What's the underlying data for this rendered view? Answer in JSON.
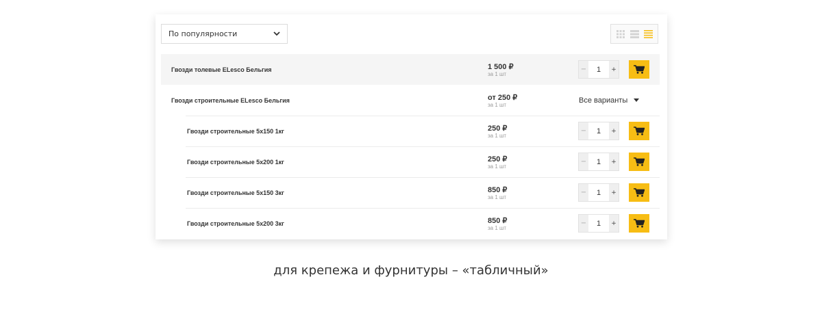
{
  "sort": {
    "selected": "По популярности"
  },
  "view_modes": [
    {
      "name": "grid",
      "active": false
    },
    {
      "name": "list",
      "active": false
    },
    {
      "name": "table",
      "active": true
    }
  ],
  "colors": {
    "accent": "#f7bd14",
    "inactive_icon": "#d4d4d4",
    "row_shade": "#f5f5f5"
  },
  "products": [
    {
      "name": "Гвозди толевые ELesco Бельгия",
      "price": "1 500 ₽",
      "unit": "за 1 шт",
      "qty": "1"
    },
    {
      "name": "Гвозди строительные ELesco Бельгия",
      "price": "от 250 ₽",
      "unit": "за 1 шт",
      "variants_label": "Все варианты"
    },
    {
      "name": "Гвозди строительные 5х150 1кг",
      "price": "250 ₽",
      "unit": "за 1 шт",
      "qty": "1"
    },
    {
      "name": "Гвозди строительные 5х200 1кг",
      "price": "250 ₽",
      "unit": "за 1 шт",
      "qty": "1"
    },
    {
      "name": "Гвозди строительные 5х150 3кг",
      "price": "850 ₽",
      "unit": "за 1 шт",
      "qty": "1"
    },
    {
      "name": "Гвозди строительные 5х200 3кг",
      "price": "850 ₽",
      "unit": "за 1 шт",
      "qty": "1"
    }
  ],
  "qty_controls": {
    "minus": "−",
    "plus": "+"
  },
  "caption": "для крепежа и фурнитуры – «табличный»"
}
